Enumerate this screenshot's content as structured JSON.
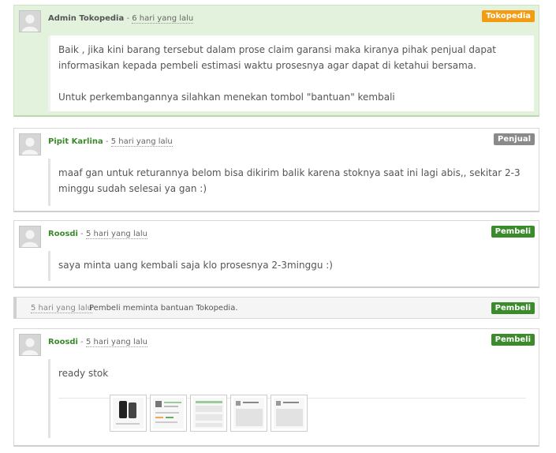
{
  "comments": [
    {
      "author": "Admin Tokopedia",
      "time": "6 hari yang lalu",
      "badge": "Tokopedia",
      "paragraphs": [
        "Baik , jika kini barang tersebut dalam prose claim garansi maka kiranya pihak penjual dapat informasikan kepada pembeli estimasi waktu prosesnya agar dapat di ketahui bersama.",
        "Untuk perkembangannya silahkan menekan tombol \"bantuan\" kembali"
      ]
    },
    {
      "author": "Pipit Karlina",
      "time": "5 hari yang lalu",
      "badge": "Penjual",
      "text": "maaf gan untuk returannya belom bisa dikirim balik karena stoknya saat ini lagi abis,, sekitar 2-3 minggu sudah selesai ya gan :)"
    },
    {
      "author": "Roosdi",
      "time": "5 hari yang lalu",
      "badge": "Pembeli",
      "text": "saya minta uang kembali saja klo prosesnya 2-3minggu :)"
    },
    {
      "author": "Roosdi",
      "time": "5 hari yang lalu",
      "badge": "Pembeli",
      "text": "ready stok"
    }
  ],
  "system_event": {
    "time": "5 hari yang lalu",
    "text": "Pembeli meminta bantuan Tokopedia.",
    "badge": "Pembeli"
  },
  "separator": "-",
  "attachments": [
    "image-thumbnail-1",
    "image-thumbnail-2",
    "image-thumbnail-3",
    "image-thumbnail-4",
    "image-thumbnail-5"
  ],
  "colors": {
    "admin_bg": "#e3f2dd",
    "badge_tokopedia": "#f39c12",
    "badge_penjual": "#8a8a8a",
    "badge_pembeli": "#3b8a2c",
    "user_name": "#3a8a2a"
  }
}
